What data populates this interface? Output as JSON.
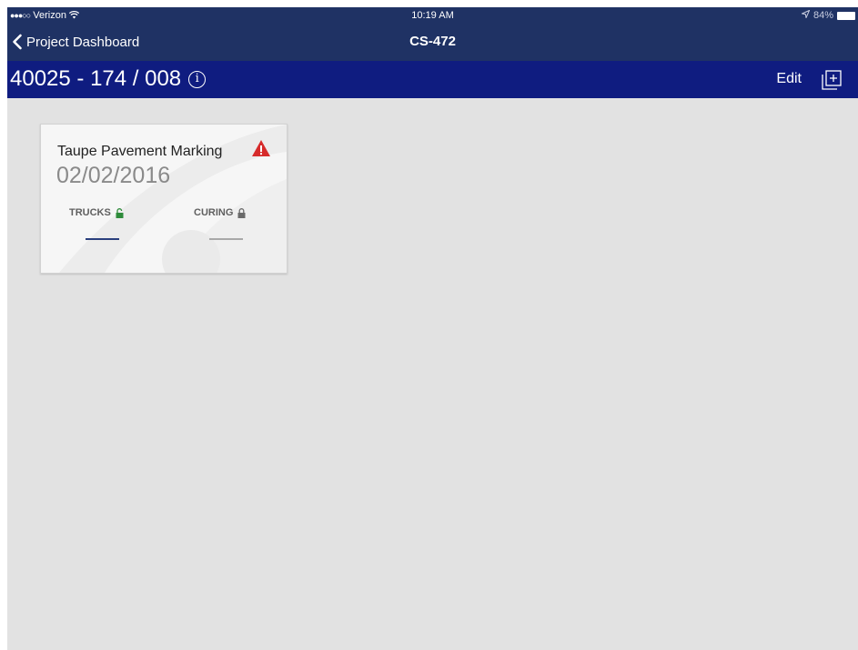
{
  "status_bar": {
    "signal": "●●●○○",
    "carrier": "Verizon",
    "time": "10:19 AM",
    "battery": "84%"
  },
  "nav": {
    "back_label": "Project Dashboard",
    "title": "CS-472"
  },
  "header": {
    "title": "40025 - 174 / 008",
    "edit_label": "Edit"
  },
  "card": {
    "title": "Taupe Pavement Marking",
    "date": "02/02/2016",
    "trucks_label": "TRUCKS",
    "trucks_value": "",
    "curing_label": "CURING",
    "curing_value": ""
  },
  "colors": {
    "nav_bg": "#1f3264",
    "header_bg": "#0f1c80",
    "content_bg": "#e2e2e2",
    "warning": "#d62b2b",
    "unlocked": "#2e8b3a"
  }
}
